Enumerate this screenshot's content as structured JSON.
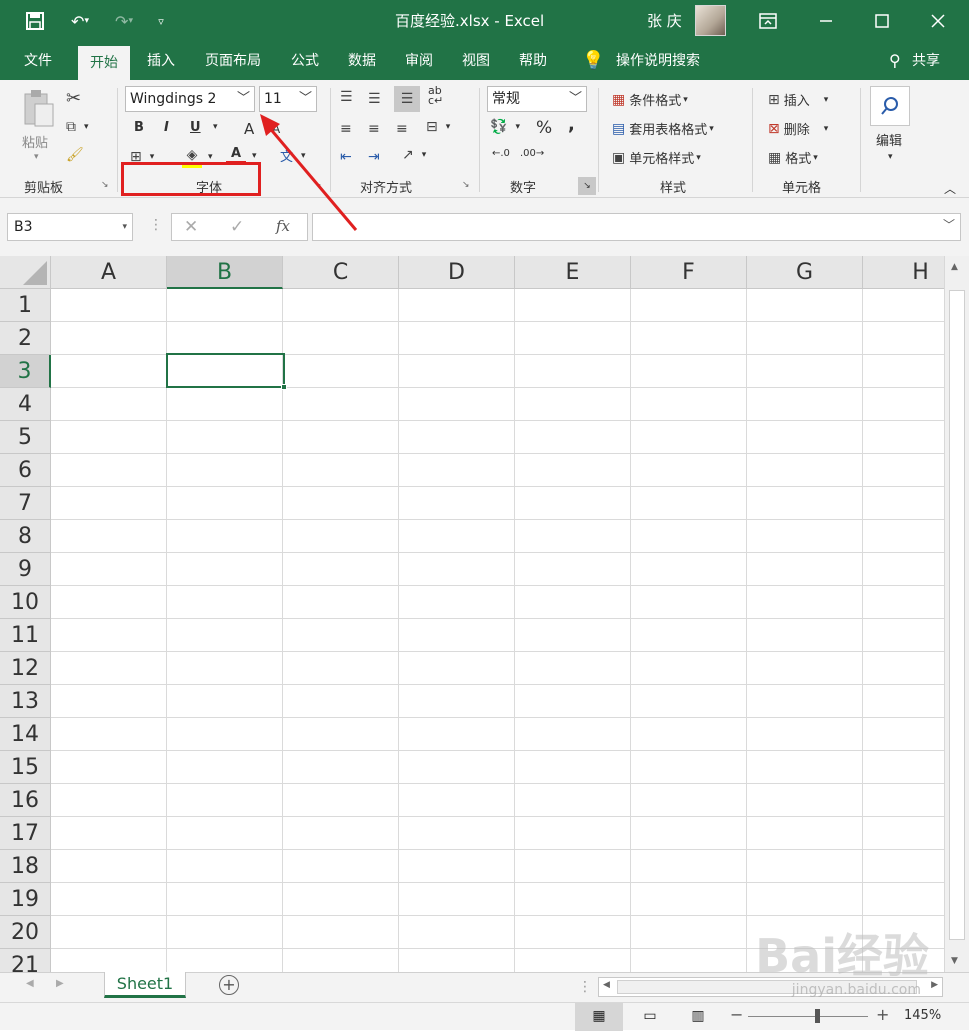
{
  "titlebar": {
    "title": "百度经验.xlsx  -  Excel",
    "user": "张 庆",
    "save_icon": "save-icon",
    "undo_icon": "undo-icon",
    "redo_icon": "redo-icon",
    "customize_icon": "customize-qat-icon"
  },
  "tabs": [
    {
      "label": "文件"
    },
    {
      "label": "开始"
    },
    {
      "label": "插入"
    },
    {
      "label": "页面布局"
    },
    {
      "label": "公式"
    },
    {
      "label": "数据"
    },
    {
      "label": "审阅"
    },
    {
      "label": "视图"
    },
    {
      "label": "帮助"
    }
  ],
  "tell_me": "操作说明搜索",
  "share": "共享",
  "ribbon": {
    "clipboard": {
      "label": "剪贴板",
      "paste": "粘贴"
    },
    "font": {
      "label": "字体",
      "font_name": "Wingdings 2",
      "font_size": "11",
      "bold": "B",
      "italic": "I",
      "underline": "U",
      "grow": "A",
      "shrink": "A",
      "font_color": "A",
      "phonetic": "文"
    },
    "alignment": {
      "label": "对齐方式"
    },
    "number": {
      "label": "数字",
      "format": "常规",
      "percent": "%",
      "comma": ","
    },
    "styles": {
      "label": "样式",
      "conditional": "条件格式",
      "table_format": "套用表格格式",
      "cell_styles": "单元格样式"
    },
    "cells": {
      "label": "单元格",
      "insert": "插入",
      "delete": "删除",
      "format": "格式"
    },
    "editing": {
      "label": "编辑"
    }
  },
  "formula_bar": {
    "name_box": "B3",
    "fx": "fx",
    "cancel": "✕",
    "enter": "✓",
    "formula": ""
  },
  "grid": {
    "columns": [
      "A",
      "B",
      "C",
      "D",
      "E",
      "F",
      "G",
      "H"
    ],
    "rows": [
      "1",
      "2",
      "3",
      "4",
      "5",
      "6",
      "7",
      "8",
      "9",
      "10",
      "11",
      "12",
      "13",
      "14",
      "15",
      "16",
      "17",
      "18",
      "19",
      "20",
      "21"
    ],
    "selected_column": "B",
    "selected_row": "3"
  },
  "sheets": [
    {
      "name": "Sheet1"
    }
  ],
  "status": {
    "zoom": "145%"
  },
  "watermark": {
    "text": "Bai经验",
    "url": "jingyan.baidu.com"
  },
  "colors": {
    "excel_green": "#217346",
    "highlight_red": "#e02020"
  }
}
